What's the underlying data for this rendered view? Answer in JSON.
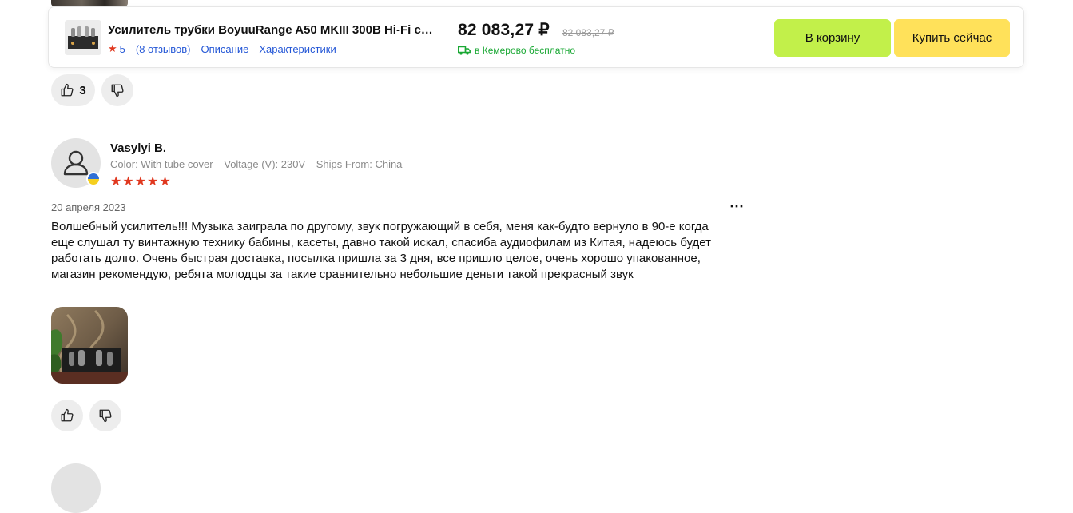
{
  "product_bar": {
    "title": "Усилитель трубки BoyuuRange A50 MKIII 300B Hi-Fi с в...",
    "rating": "5",
    "reviews_link": "(8 отзывов)",
    "description_link": "Описание",
    "specs_link": "Характеристики",
    "price": "82 083,27 ₽",
    "old_price": "82 083,27 ₽",
    "delivery": "в Кемерово бесплатно",
    "cart_button": "В корзину",
    "buy_button": "Купить сейчас"
  },
  "prev_review": {
    "like_count": "3"
  },
  "review": {
    "author": "Vasylyi B.",
    "attributes": [
      "Color: With tube cover",
      "Voltage (V): 230V",
      "Ships From: China"
    ],
    "stars": "★★★★★",
    "date": "20 апреля 2023",
    "text": "Волшебный усилитель!!! Музыка заиграла по другому, звук погружающий в себя, меня как-будто вернуло в 90-е когда еще слушал ту винтажную технику бабины, касеты, давно такой искал, спасиба аудиофилам  из Китая, надеюсь будет работать долго. Очень быстрая доставка, посылка пришла за 3 дня, все пришло целое, очень хорошо упакованное, магазин рекомендую, ребята молодцы за такие сравнительно небольшие деньги такой прекрасный звук",
    "more_icon": "⋯"
  },
  "colors": {
    "accent_link": "#2457d6",
    "star": "#e0381f",
    "delivery": "#1aa834",
    "cart_button": "#c2f04a",
    "buy_button": "#ffe15a"
  },
  "icons": {
    "like": "thumbs-up-icon",
    "dislike": "thumbs-down-icon",
    "truck": "truck-icon",
    "user": "user-icon",
    "more": "more-icon"
  }
}
